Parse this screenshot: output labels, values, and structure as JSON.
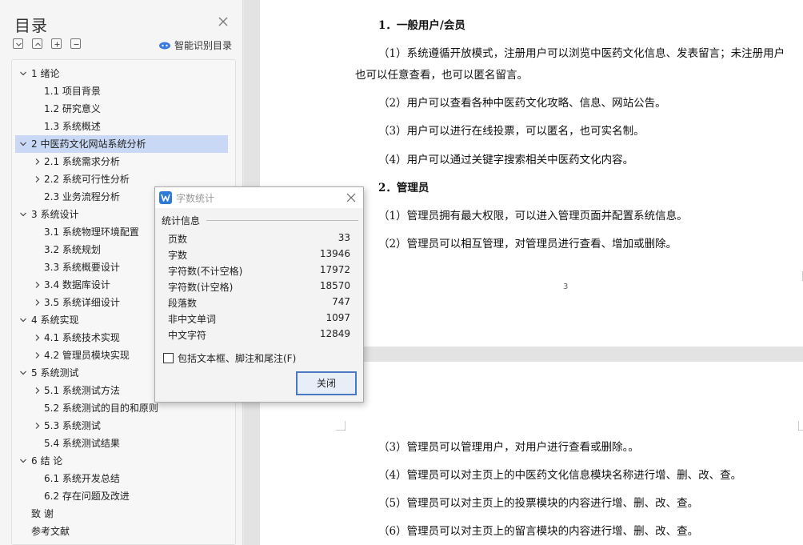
{
  "sidebar": {
    "title": "目录",
    "smart_toc_label": "智能识别目录",
    "items": [
      {
        "label": "1  绪论",
        "level": 0,
        "chevron": "down",
        "active": false
      },
      {
        "label": "1.1  项目背景",
        "level": 1,
        "chevron": "none",
        "active": false
      },
      {
        "label": "1.2  研究意义",
        "level": 1,
        "chevron": "none",
        "active": false
      },
      {
        "label": "1.3  系统概述",
        "level": 1,
        "chevron": "none",
        "active": false
      },
      {
        "label": "2  中医药文化网站系统分析",
        "level": 0,
        "chevron": "down",
        "active": true
      },
      {
        "label": "2.1  系统需求分析",
        "level": 1,
        "chevron": "right",
        "active": false
      },
      {
        "label": "2.2  系统可行性分析",
        "level": 1,
        "chevron": "right",
        "active": false
      },
      {
        "label": "2.3  业务流程分析",
        "level": 1,
        "chevron": "none",
        "active": false
      },
      {
        "label": "3 系统设计",
        "level": 0,
        "chevron": "down",
        "active": false
      },
      {
        "label": "3.1  系统物理环境配置",
        "level": 1,
        "chevron": "none",
        "active": false
      },
      {
        "label": "3.2  系统规划",
        "level": 1,
        "chevron": "none",
        "active": false
      },
      {
        "label": "3.3  系统概要设计",
        "level": 1,
        "chevron": "none",
        "active": false
      },
      {
        "label": "3.4  数据库设计",
        "level": 1,
        "chevron": "right",
        "active": false
      },
      {
        "label": "3.5  系统详细设计",
        "level": 1,
        "chevron": "right",
        "active": false
      },
      {
        "label": "4 系统实现",
        "level": 0,
        "chevron": "down",
        "active": false
      },
      {
        "label": "4.1  系统技术实现",
        "level": 1,
        "chevron": "right",
        "active": false
      },
      {
        "label": "4.2  管理员模块实现",
        "level": 1,
        "chevron": "right",
        "active": false
      },
      {
        "label": "5  系统测试",
        "level": 0,
        "chevron": "down",
        "active": false
      },
      {
        "label": "5.1  系统测试方法",
        "level": 1,
        "chevron": "right",
        "active": false
      },
      {
        "label": "5.2  系统测试的目的和原则",
        "level": 1,
        "chevron": "none",
        "active": false
      },
      {
        "label": "5.3  系统测试",
        "level": 1,
        "chevron": "right",
        "active": false
      },
      {
        "label": "5.4  系统测试结果",
        "level": 1,
        "chevron": "none",
        "active": false
      },
      {
        "label": "6  结  论",
        "level": 0,
        "chevron": "down",
        "active": false
      },
      {
        "label": "6.1  系统开发总结",
        "level": 1,
        "chevron": "none",
        "active": false
      },
      {
        "label": "6.2  存在问题及改进",
        "level": 1,
        "chevron": "none",
        "active": false
      },
      {
        "label": "致  谢",
        "level": 0,
        "chevron": "none",
        "active": false
      },
      {
        "label": "参考文献",
        "level": 0,
        "chevron": "none",
        "active": false
      }
    ]
  },
  "document": {
    "page1_lines": [
      {
        "text": "1．一般用户/会员",
        "head": true
      },
      {
        "text": "（1）系统遵循开放模式，注册用户可以浏览中医药文化信息、发表留言；未注册用户",
        "head": false
      },
      {
        "text": "也可以任意查看，也可以匿名留言。",
        "head": false
      },
      {
        "text": "（2）用户可以查看各种中医药文化攻略、信息、网站公告。",
        "head": false
      },
      {
        "text": "（3）用户可以进行在线投票，可以匿名，也可实名制。",
        "head": false
      },
      {
        "text": "（4）用户可以通过关键字搜索相关中医药文化内容。",
        "head": false
      },
      {
        "text": "2．管理员",
        "head": true
      },
      {
        "text": "（1）管理员拥有最大权限，可以进入管理页面并配置系统信息。",
        "head": false
      },
      {
        "text": "（2）管理员可以相互管理，对管理员进行查看、增加或删除。",
        "head": false
      }
    ],
    "page_number": "3",
    "page2_lines": [
      {
        "text": "（3）管理员可以管理用户，对用户进行查看或删除。。",
        "head": false
      },
      {
        "text": "（4）管理员可以对主页上的中医药文化信息模块名称进行增、删、改、查。",
        "head": false
      },
      {
        "text": "（5）管理员可以对主页上的投票模块的内容进行增、删、改、查。",
        "head": false
      },
      {
        "text": "（6）管理员可以对主页上的留言模块的内容进行增、删、改、查。",
        "head": false
      }
    ]
  },
  "word_count": {
    "title": "字数统计",
    "section_label": "统计信息",
    "rows": [
      {
        "label": "页数",
        "value": "33"
      },
      {
        "label": "字数",
        "value": "13946"
      },
      {
        "label": "字符数(不计空格)",
        "value": "17972"
      },
      {
        "label": "字符数(计空格)",
        "value": "18570"
      },
      {
        "label": "段落数",
        "value": "747"
      },
      {
        "label": "非中文单词",
        "value": "1097"
      },
      {
        "label": "中文字符",
        "value": "12849"
      }
    ],
    "checkbox_label": "包括文本框、脚注和尾注(F)",
    "checkbox_checked": false,
    "close_label": "关闭"
  },
  "icons": {
    "toc_close": "close-icon",
    "collapse_all": "collapse-all-icon",
    "expand_level": "expand-level-icon",
    "add_heading": "plus-icon",
    "remove_heading": "minus-icon",
    "smart_toc": "ai-cloud-icon",
    "dialog_logo": "wps-writer-icon",
    "dialog_close": "close-icon"
  },
  "colors": {
    "active_toc_bg": "#c9d9f5",
    "accent": "#4a79c4",
    "dialog_logo": "#2d7bd9"
  }
}
